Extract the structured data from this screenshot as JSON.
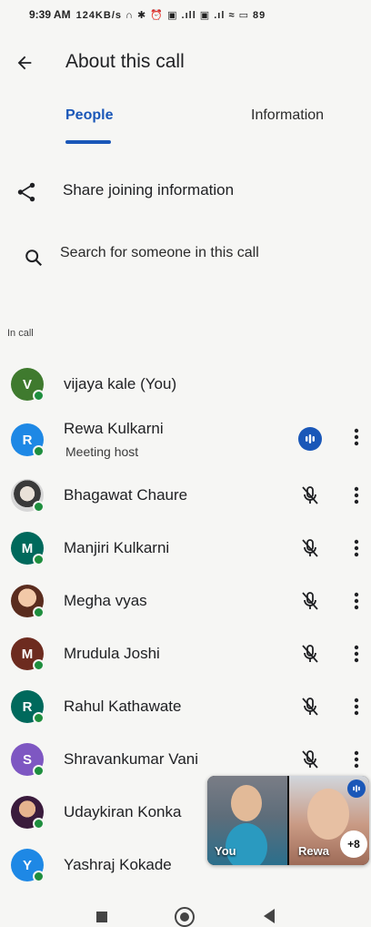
{
  "status_bar": {
    "time": "9:39 AM",
    "icons_text": "124KB/s ∩ ✱ ⏰ ▣ .ıll ▣ .ıl ≈ ▭ 89"
  },
  "header": {
    "title": "About this call"
  },
  "tabs": [
    {
      "label": "People",
      "active": true
    },
    {
      "label": "Information",
      "active": false
    }
  ],
  "share": {
    "label": "Share joining information",
    "icon": "share-icon"
  },
  "search": {
    "placeholder": "Search for someone in this call",
    "icon": "search-icon"
  },
  "section_label": "In call",
  "participants": [
    {
      "name": "vijaya kale (You)",
      "initial": "V",
      "color": "#3f7a2e",
      "mic": "none"
    },
    {
      "name": "Rewa Kulkarni",
      "subtitle": "Meeting host",
      "initial": "R",
      "color": "#1e88e5",
      "mic": "speaking"
    },
    {
      "name": "Bhagawat Chaure",
      "initial": "",
      "color": "#cccccc",
      "mic": "muted"
    },
    {
      "name": "Manjiri Kulkarni",
      "initial": "M",
      "color": "#00695c",
      "mic": "muted"
    },
    {
      "name": "Megha vyas",
      "initial": "",
      "color": "#7b3b2a",
      "mic": "muted"
    },
    {
      "name": "Mrudula Joshi",
      "initial": "M",
      "color": "#6d2b1f",
      "mic": "muted"
    },
    {
      "name": "Rahul Kathawate",
      "initial": "R",
      "color": "#00695c",
      "mic": "muted"
    },
    {
      "name": "Shravankumar Vani",
      "initial": "S",
      "color": "#7e57c2",
      "mic": "muted"
    },
    {
      "name": "Udaykiran Konka",
      "initial": "",
      "color": "#4a1f4f",
      "mic": "none"
    },
    {
      "name": "Yashraj Kokade",
      "initial": "Y",
      "color": "#1e88e5",
      "mic": "none"
    }
  ],
  "pip": {
    "you_label": "You",
    "other_label": "Rewa",
    "more_count": "+8"
  },
  "colors": {
    "accent": "#1a57b8",
    "online": "#1e8e3e"
  }
}
